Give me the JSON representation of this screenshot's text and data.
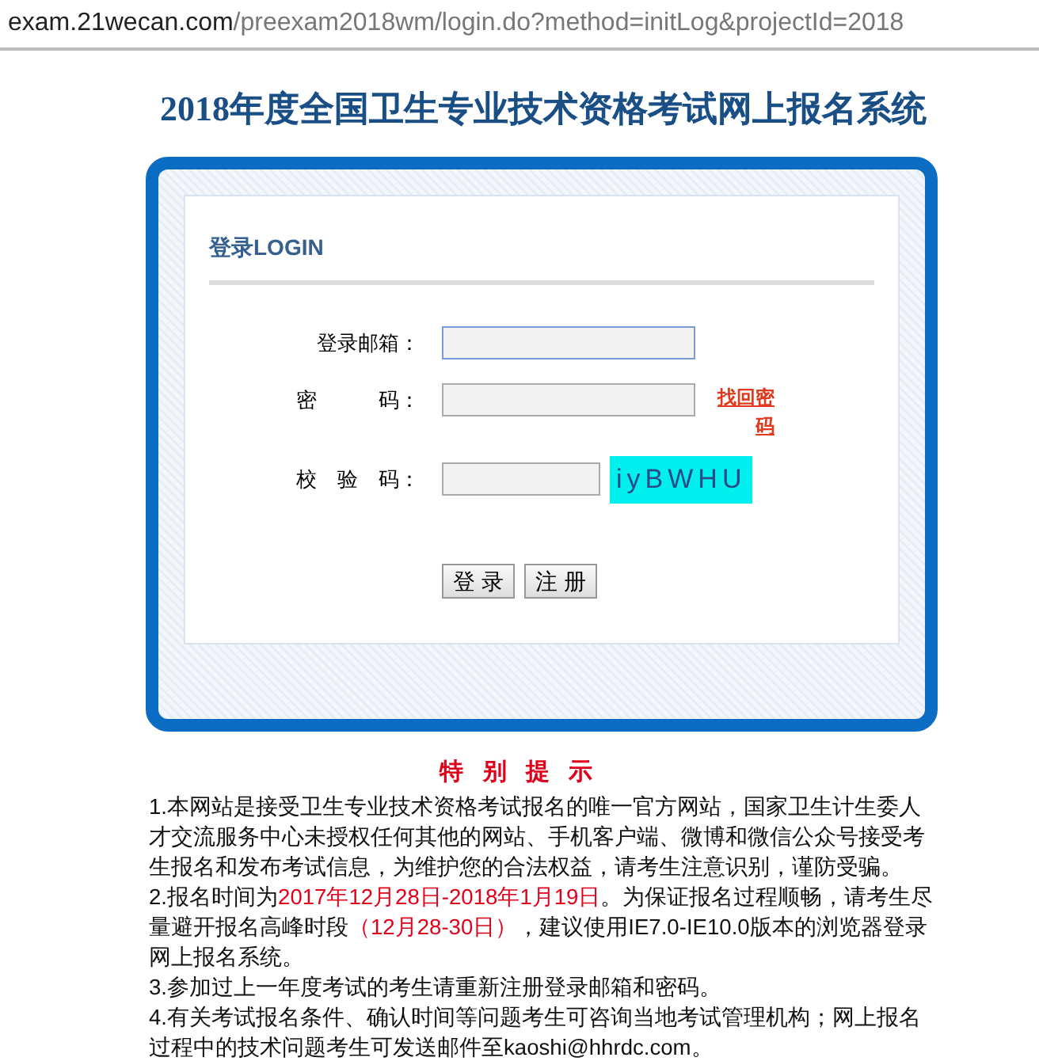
{
  "address_bar": {
    "domain": "exam.21wecan.com",
    "path": "/preexam2018wm/login.do?method=initLog&projectId=2018"
  },
  "page_title": "2018年度全国卫生专业技术资格考试网上报名系统",
  "login": {
    "heading": "登录LOGIN",
    "fields": [
      {
        "label": "登录邮箱：",
        "kind": "text",
        "focused": true
      },
      {
        "label": "密　　　码：",
        "kind": "password",
        "focused": false,
        "link": "找回密码"
      },
      {
        "label": "校　验　码：",
        "kind": "captcha",
        "focused": false,
        "captcha": "iyBWHU"
      }
    ],
    "buttons": [
      "登 录",
      "注 册"
    ]
  },
  "notice": {
    "title": "特 别 提 示",
    "items": [
      [
        {
          "text": "1.本网站是接受卫生专业技术资格考试报名的唯一官方网站，国家卫生计生委人才交流服务中心未授权任何其他的网站、手机客户端、微博和微信公众号接受考生报名和发布考试信息，为维护您的合法权益，请考生注意识别，谨防受骗。",
          "highlight": false
        }
      ],
      [
        {
          "text": "2.报名时间为",
          "highlight": false
        },
        {
          "text": "2017年12月28日-2018年1月19日",
          "highlight": true
        },
        {
          "text": "。为保证报名过程顺畅，请考生尽量避开报名高峰时段",
          "highlight": false
        },
        {
          "text": "（12月28-30日）",
          "highlight": true
        },
        {
          "text": "，建议使用IE7.0-IE10.0版本的浏览器登录网上报名系统。",
          "highlight": false
        }
      ],
      [
        {
          "text": "3.参加过上一年度考试的考生请重新注册登录邮箱和密码。",
          "highlight": false
        }
      ],
      [
        {
          "text": "4.有关考试报名条件、确认时间等问题考生可咨询当地考试管理机构；网上报名过程中的技术问题考生可发送邮件至kaoshi@hhrdc.com。",
          "highlight": false
        }
      ]
    ]
  }
}
